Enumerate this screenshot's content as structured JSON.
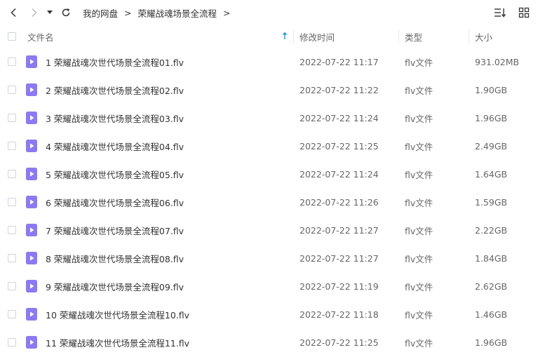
{
  "toolbar": {
    "back_icon": "chevron-left-icon",
    "forward_icon": "chevron-right-icon",
    "dropdown_icon": "caret-down-icon",
    "refresh_icon": "refresh-icon",
    "breadcrumb": [
      {
        "label": "我的网盘"
      },
      {
        "label": "荣耀战魂场景全流程"
      }
    ],
    "separator": ">",
    "sort_view_icon": "sort-list-icon",
    "grid_view_icon": "grid-view-icon"
  },
  "header": {
    "name": "文件名",
    "mtime": "修改时间",
    "type": "类型",
    "size": "大小",
    "sort_icon": "sort-ascending-icon"
  },
  "colors": {
    "file_icon": "#8a7bf0",
    "sort_arrow": "#2e9be6",
    "text": "#333333",
    "muted": "#666666"
  },
  "files": [
    {
      "name": "1 荣耀战魂次世代场景全流程01.flv",
      "mtime": "2022-07-22 11:17",
      "type": "flv文件",
      "size": "931.02MB"
    },
    {
      "name": "2 荣耀战魂次世代场景全流程02.flv",
      "mtime": "2022-07-22 11:22",
      "type": "flv文件",
      "size": "1.90GB"
    },
    {
      "name": "3 荣耀战魂次世代场景全流程03.flv",
      "mtime": "2022-07-22 11:24",
      "type": "flv文件",
      "size": "1.96GB"
    },
    {
      "name": "4 荣耀战魂次世代场景全流程04.flv",
      "mtime": "2022-07-22 11:25",
      "type": "flv文件",
      "size": "2.49GB"
    },
    {
      "name": "5 荣耀战魂次世代场景全流程05.flv",
      "mtime": "2022-07-22 11:24",
      "type": "flv文件",
      "size": "1.64GB"
    },
    {
      "name": "6 荣耀战魂次世代场景全流程06.flv",
      "mtime": "2022-07-22 11:26",
      "type": "flv文件",
      "size": "1.59GB"
    },
    {
      "name": "7 荣耀战魂次世代场景全流程07.flv",
      "mtime": "2022-07-22 11:27",
      "type": "flv文件",
      "size": "2.22GB"
    },
    {
      "name": "8 荣耀战魂次世代场景全流程08.flv",
      "mtime": "2022-07-22 11:27",
      "type": "flv文件",
      "size": "1.84GB"
    },
    {
      "name": "9 荣耀战魂次世代场景全流程09.flv",
      "mtime": "2022-07-22 11:19",
      "type": "flv文件",
      "size": "2.62GB"
    },
    {
      "name": "10 荣耀战魂次世代场景全流程10.flv",
      "mtime": "2022-07-22 11:18",
      "type": "flv文件",
      "size": "1.46GB"
    },
    {
      "name": "11 荣耀战魂次世代场景全流程11.flv",
      "mtime": "2022-07-22 11:25",
      "type": "flv文件",
      "size": "1.96GB"
    }
  ]
}
